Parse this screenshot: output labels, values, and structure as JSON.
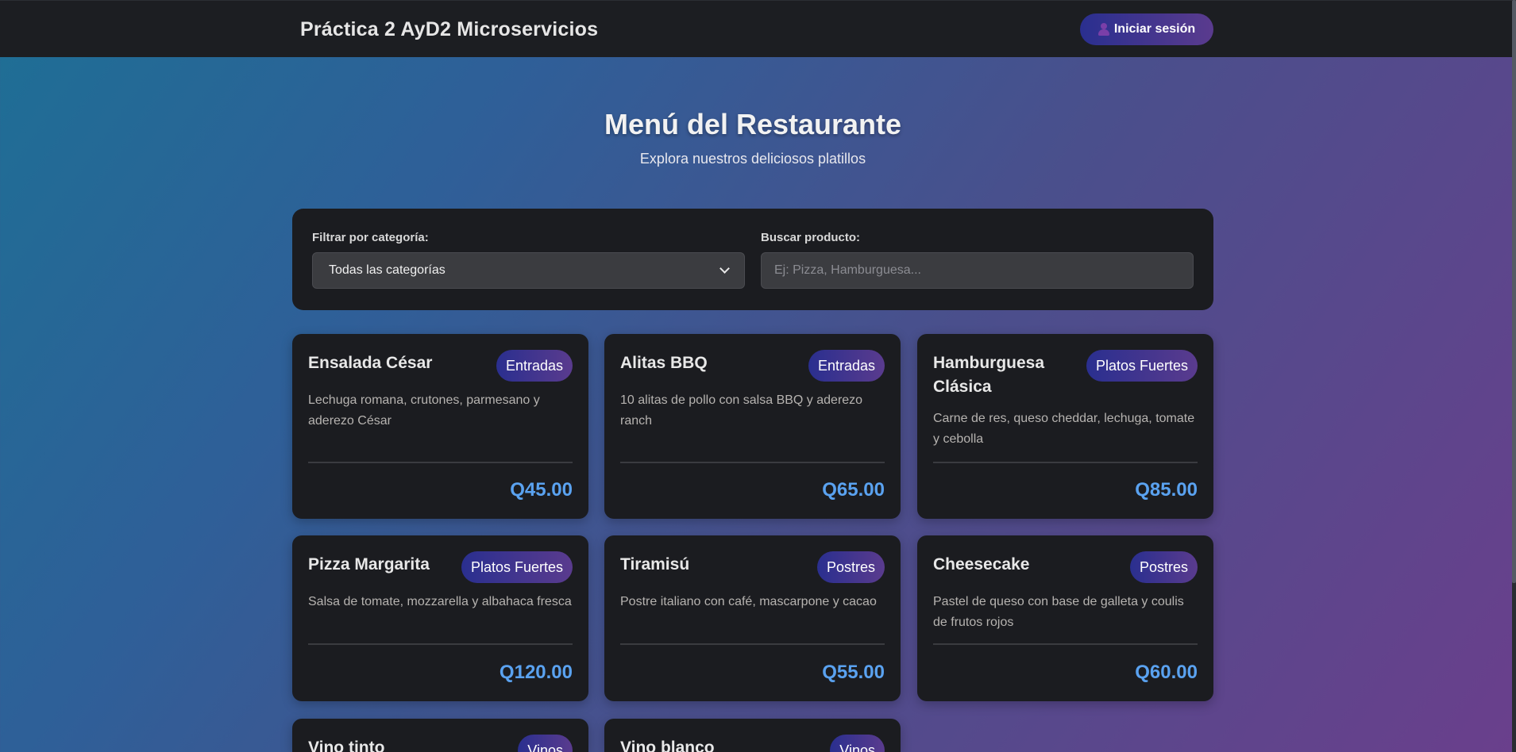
{
  "navbar": {
    "brand": "Práctica 2 AyD2 Microservicios",
    "login_label": "Iniciar sesión"
  },
  "hero": {
    "title": "Menú del Restaurante",
    "subtitle": "Explora nuestros deliciosos platillos"
  },
  "filters": {
    "category_label": "Filtrar por categoría:",
    "category_selected": "Todas las categorías",
    "search_label": "Buscar producto:",
    "search_placeholder": "Ej: Pizza, Hamburguesa...",
    "search_value": ""
  },
  "products": [
    {
      "name": "Ensalada César",
      "category": "Entradas",
      "description": "Lechuga romana, crutones, parmesano y aderezo César",
      "price": "Q45.00"
    },
    {
      "name": "Alitas BBQ",
      "category": "Entradas",
      "description": "10 alitas de pollo con salsa BBQ y aderezo ranch",
      "price": "Q65.00"
    },
    {
      "name": "Hamburguesa Clásica",
      "category": "Platos Fuertes",
      "description": "Carne de res, queso cheddar, lechuga, tomate y cebolla",
      "price": "Q85.00"
    },
    {
      "name": "Pizza Margarita",
      "category": "Platos Fuertes",
      "description": "Salsa de tomate, mozzarella y albahaca fresca",
      "price": "Q120.00"
    },
    {
      "name": "Tiramisú",
      "category": "Postres",
      "description": "Postre italiano con café, mascarpone y cacao",
      "price": "Q55.00"
    },
    {
      "name": "Cheesecake",
      "category": "Postres",
      "description": "Pastel de queso con base de galleta y coulis de frutos rojos",
      "price": "Q60.00"
    },
    {
      "name": "Vino tinto",
      "category": "Vinos"
    },
    {
      "name": "Vino blanco",
      "category": "Vinos"
    }
  ],
  "colors": {
    "accent_start": "#2a2f8f",
    "accent_end": "#5a3b8e",
    "price": "#5aa2f0",
    "card_bg": "#1b1c20"
  }
}
